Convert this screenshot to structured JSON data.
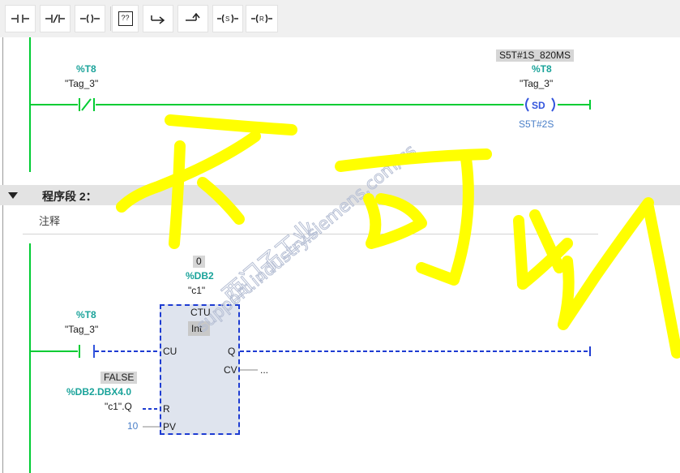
{
  "toolbar": {
    "buttons": [
      {
        "name": "normally-open-contact-icon",
        "label": "⊣⊢"
      },
      {
        "name": "normally-closed-contact-icon",
        "label": "⊣/⊢"
      },
      {
        "name": "coil-icon",
        "label": "–()–"
      },
      {
        "name": "empty-box-icon",
        "label": "??"
      },
      {
        "name": "open-branch-icon",
        "label": "↳"
      },
      {
        "name": "close-branch-icon",
        "label": "↱"
      },
      {
        "name": "set-coil-icon",
        "label": "(S)"
      },
      {
        "name": "reset-coil-icon",
        "label": "(R)"
      }
    ],
    "box_label": "??",
    "set_label": "S",
    "reset_label": "R"
  },
  "network1": {
    "contact_address": "%T8",
    "contact_tag": "\"Tag_3\"",
    "coil_value": "S5T#1S_820MS",
    "coil_address": "%T8",
    "coil_tag": "\"Tag_3\"",
    "coil_label": "SD",
    "coil_time": "S5T#2S"
  },
  "network2": {
    "segment_title": "程序段 2：",
    "segment_dots": "......",
    "comment_placeholder": "注释",
    "instance_value": "0",
    "instance_db": "%DB2",
    "instance_name": "\"c1\"",
    "contact_address": "%T8",
    "contact_tag": "\"Tag_3\"",
    "block_type": "CTU",
    "block_datatype": "Int",
    "pin_cu": "CU",
    "pin_q": "Q",
    "pin_cv": "CV",
    "pin_r": "R",
    "pin_pv": "PV",
    "cv_output": "...",
    "reset_value": "FALSE",
    "reset_address": "%DB2.DBX4.0",
    "reset_tag": "\"c1\".Q",
    "pv_value": "10"
  },
  "overlay": {
    "watermark_lines": [
      "西门子工业",
      "support.industry.siemens.com/cs"
    ],
    "handwritten_text": "不可以",
    "handwriting_color": "#ffff00"
  }
}
